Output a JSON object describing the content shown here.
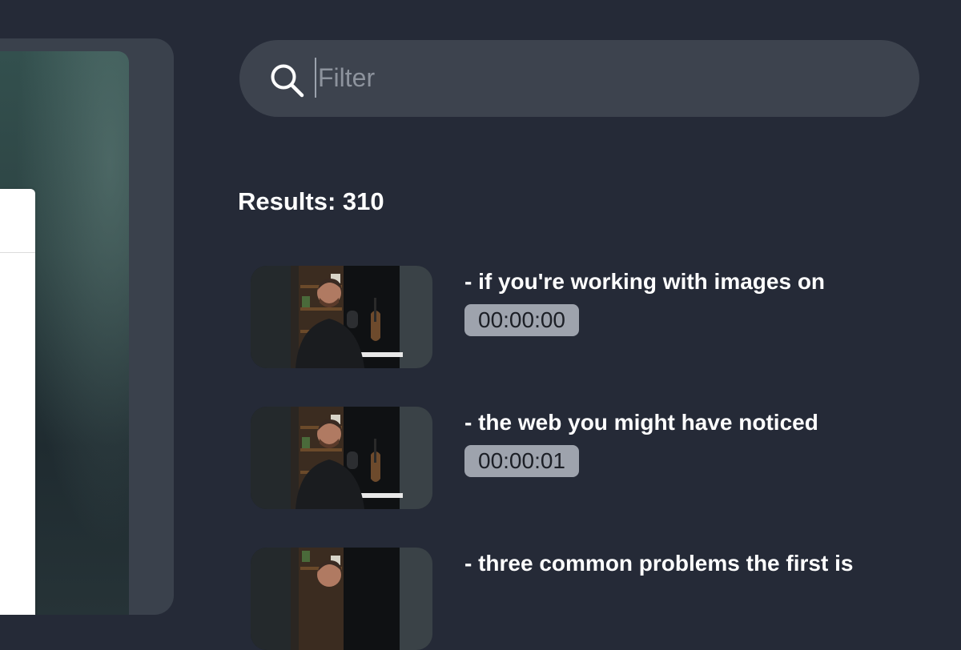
{
  "filter": {
    "placeholder": "Filter",
    "value": "",
    "icon": "search-icon"
  },
  "results": {
    "label": "Results: 310",
    "items": [
      {
        "text": "- if you're working with images on",
        "timestamp": "00:00:00"
      },
      {
        "text": "- the web you might have noticed",
        "timestamp": "00:00:01"
      },
      {
        "text": "- three common problems the first is",
        "timestamp": ""
      }
    ]
  },
  "colors": {
    "background": "#252a37",
    "filter_bar": "#3d434e",
    "timestamp_badge": "#9ea3ad",
    "text": "#ffffff"
  }
}
